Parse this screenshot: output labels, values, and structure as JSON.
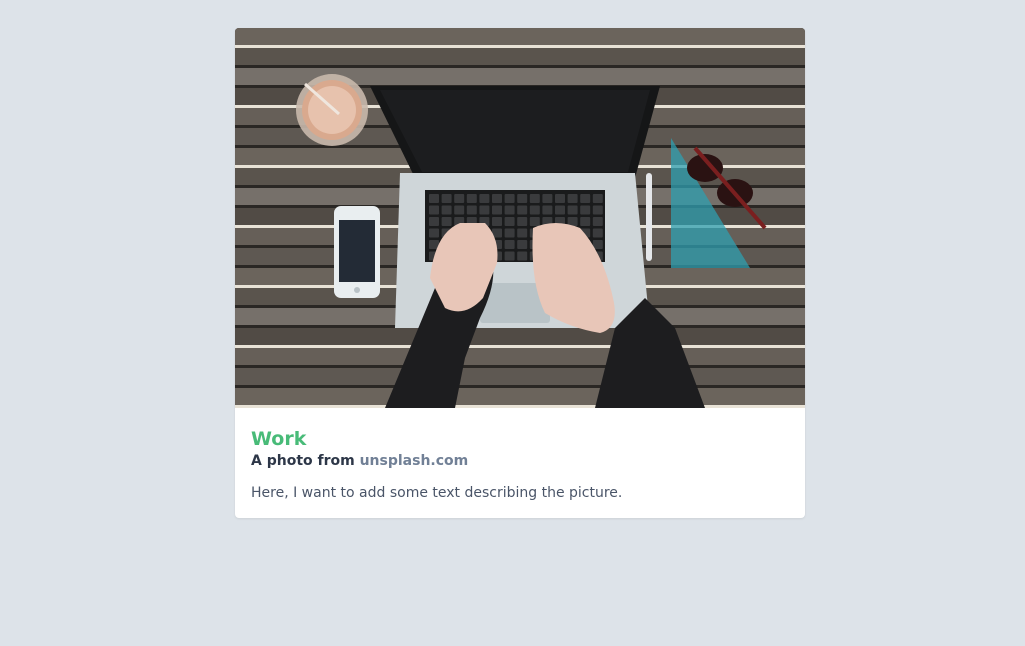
{
  "card": {
    "image_alt": "Laptop on a wooden table with hands typing, a phone, a drink and a set square",
    "title": "Work",
    "subtitle_prefix": "A photo from",
    "subtitle_link": "unsplash.com",
    "description": "Here, I want to add some text describing the picture."
  },
  "colors": {
    "background": "#dde3e9",
    "title": "#48bb78",
    "link": "#718096",
    "text": "#4a5568"
  }
}
